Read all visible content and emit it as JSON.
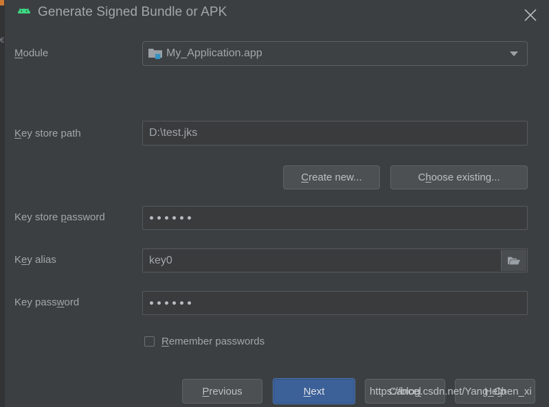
{
  "window": {
    "title": "Generate Signed Bundle or APK",
    "app_icon": "android-robot-icon",
    "close_label": "×"
  },
  "form": {
    "module": {
      "label_prefix": "M",
      "label_rest": "odule",
      "value": "My_Application.app",
      "icon": "module-folder-icon",
      "arrow": "chevron-down-icon"
    },
    "key_store_path": {
      "label_prefix": "K",
      "label_rest": "ey store path",
      "value": "D:\\test.jks"
    },
    "create_new_button": {
      "prefix": "C",
      "underlined": "",
      "rest": "reate new..."
    },
    "choose_existing_button": {
      "pre": "C",
      "underlined": "h",
      "rest": "oose existing..."
    },
    "key_store_password": {
      "pre": "Key store ",
      "underlined": "p",
      "rest": "assword",
      "value": "••••••",
      "dot_count": 6
    },
    "key_alias": {
      "pre": "K",
      "underlined": "e",
      "rest": "y alias",
      "value": "key0",
      "browse_icon": "open-folder-icon"
    },
    "key_password": {
      "pre": "Key pass",
      "underlined": "w",
      "rest": "ord",
      "value": "••••••",
      "dot_count": 6
    },
    "remember_passwords": {
      "underlined": "R",
      "rest": "emember passwords",
      "checked": false
    }
  },
  "footer": {
    "previous": {
      "underlined": "P",
      "rest": "revious"
    },
    "next": {
      "underlined": "N",
      "rest": "ext"
    },
    "cancel": {
      "pre": "Cance",
      "underlined": "l",
      "rest": ""
    },
    "help": {
      "pre": "He",
      "underlined": "l",
      "rest": "p"
    }
  },
  "watermark": "https://blog.csdn.net/Yang_Chen_xi",
  "colors": {
    "dialog_bg": "#3c3f41",
    "field_bg": "#393b3d",
    "text": "#a2a7ab",
    "accent_blue": "#3c6098",
    "android_green": "#3ddc84",
    "module_blue": "#3592c4"
  }
}
